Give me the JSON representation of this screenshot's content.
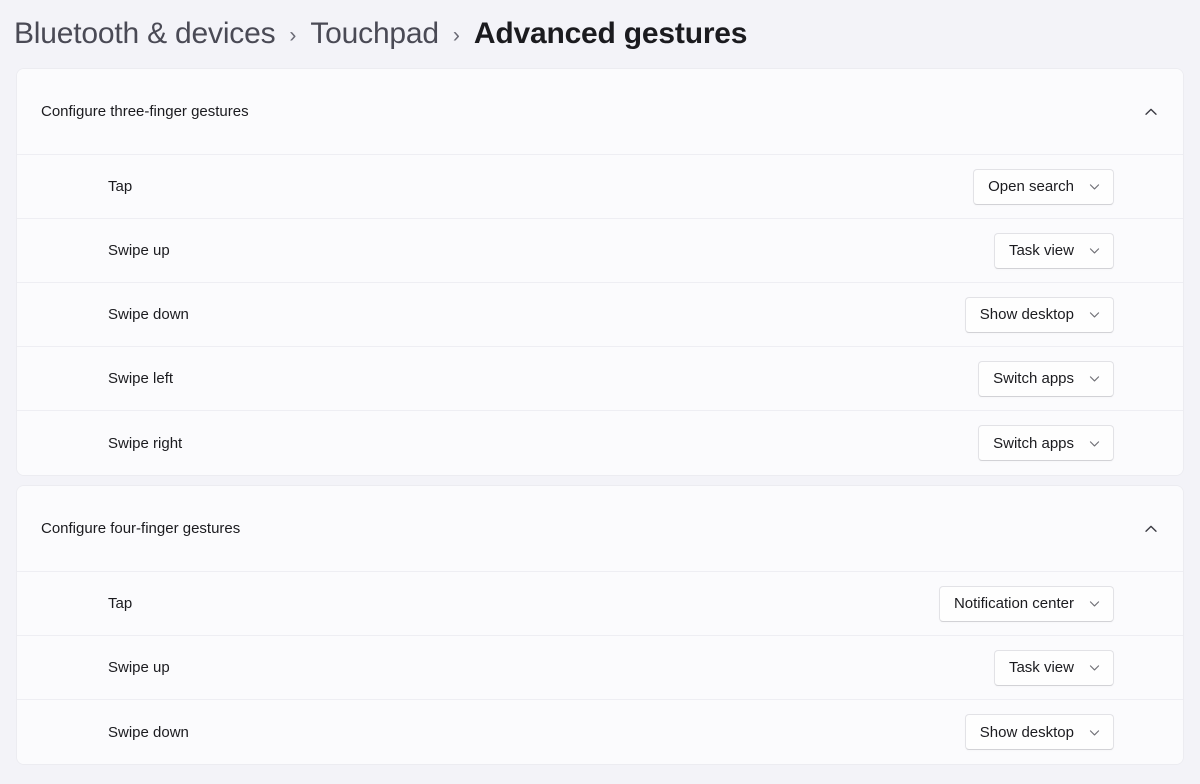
{
  "breadcrumb": {
    "items": [
      {
        "label": "Bluetooth & devices",
        "current": false
      },
      {
        "label": "Touchpad",
        "current": false
      },
      {
        "label": "Advanced gestures",
        "current": true
      }
    ],
    "separator": "›"
  },
  "colors": {
    "page_background": "#f3f3f8",
    "card_background": "#fbfbfd",
    "divider": "#eeeef3",
    "text_primary": "#1b1b1f",
    "text_secondary": "#4a4a55",
    "control_border": "#e2e2e6"
  },
  "sections": [
    {
      "title": "Configure three-finger gestures",
      "expanded": true,
      "toggle_icon": "chevron-up-icon",
      "rows": [
        {
          "label": "Tap",
          "value": "Open search"
        },
        {
          "label": "Swipe up",
          "value": "Task view"
        },
        {
          "label": "Swipe down",
          "value": "Show desktop"
        },
        {
          "label": "Swipe left",
          "value": "Switch apps"
        },
        {
          "label": "Swipe right",
          "value": "Switch apps"
        }
      ]
    },
    {
      "title": "Configure four-finger gestures",
      "expanded": true,
      "toggle_icon": "chevron-up-icon",
      "rows": [
        {
          "label": "Tap",
          "value": "Notification center"
        },
        {
          "label": "Swipe up",
          "value": "Task view"
        },
        {
          "label": "Swipe down",
          "value": "Show desktop"
        }
      ]
    }
  ]
}
